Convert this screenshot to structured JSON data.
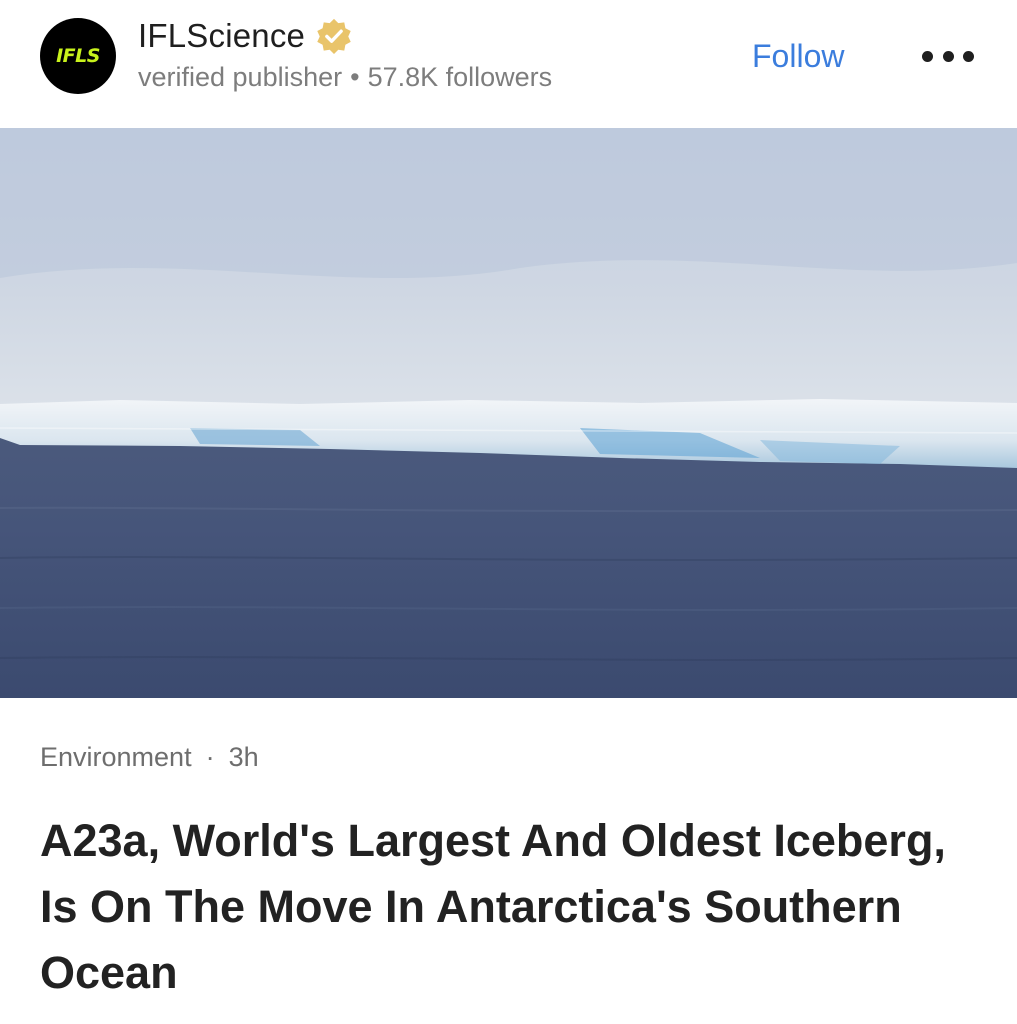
{
  "publisher": {
    "avatar_text": "IFLS",
    "name": "IFLScience",
    "status": "verified publisher",
    "separator": "•",
    "followers": "57.8K followers",
    "badge_icon": "verified-badge-icon"
  },
  "actions": {
    "follow_label": "Follow",
    "more_icon": "more-options-icon"
  },
  "article": {
    "category": "Environment",
    "separator": "·",
    "time_ago": "3h",
    "headline": "A23a, World's Largest And Oldest Iceberg, Is On The Move In Antarctica's Southern Ocean",
    "image_alt": "Iceberg on ocean"
  },
  "colors": {
    "follow": "#3b7ddd",
    "badge": "#e9c46a",
    "avatar_bg": "#000000",
    "avatar_text": "#c8f21c",
    "muted_text": "#7d7d7d"
  }
}
